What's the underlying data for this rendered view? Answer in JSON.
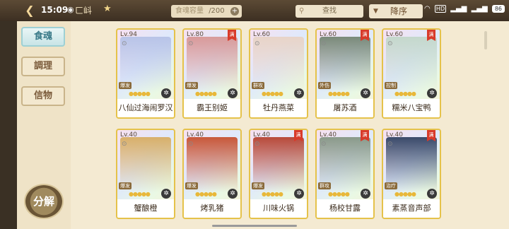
{
  "status_bar": {
    "time": "15:09",
    "wechat_icon": "wechat-icon",
    "title": "ㄈ㞳",
    "star_icon": "star-icon",
    "battery": "86",
    "hd": "HD"
  },
  "header": {
    "capacity_label": "食魂容量",
    "capacity_current": "",
    "capacity_total": "/200",
    "search_label": "查找",
    "sort_label": "降序"
  },
  "sidebar": {
    "tabs": [
      {
        "label": "食魂",
        "active": true
      },
      {
        "label": "調理",
        "active": false
      },
      {
        "label": "信物",
        "active": false
      }
    ],
    "decompose_label": "分解"
  },
  "cards": [
    {
      "level": "Lv.94",
      "name": "八仙过海闹罗汉",
      "tag": "爆发",
      "ribbon": false,
      "color": "#b8c4e8"
    },
    {
      "level": "Lv.80",
      "name": "霸王别姬",
      "tag": "爆发",
      "ribbon": true,
      "color": "#d89a9a"
    },
    {
      "level": "Lv.60",
      "name": "牡丹燕菜",
      "tag": "群攻",
      "ribbon": false,
      "color": "#e8d4c8"
    },
    {
      "level": "Lv.60",
      "name": "屠苏酒",
      "tag": "外伤",
      "ribbon": true,
      "color": "#7a8a7a"
    },
    {
      "level": "Lv.60",
      "name": "糯米八宝鸭",
      "tag": "控制",
      "ribbon": true,
      "color": "#c4d8cc"
    },
    {
      "level": "Lv.40",
      "name": "蟹酿橙",
      "tag": "爆发",
      "ribbon": false,
      "color": "#d8b06a"
    },
    {
      "level": "Lv.40",
      "name": "烤乳猪",
      "tag": "爆发",
      "ribbon": false,
      "color": "#c8583a"
    },
    {
      "level": "Lv.40",
      "name": "川味火锅",
      "tag": "爆发",
      "ribbon": true,
      "color": "#b84a3a"
    },
    {
      "level": "Lv.40",
      "name": "杨校甘露",
      "tag": "群攻",
      "ribbon": true,
      "color": "#8a9a8a"
    },
    {
      "level": "Lv.40",
      "name": "素蒸音声部",
      "tag": "治疗",
      "ribbon": true,
      "color": "#3a4a6a"
    }
  ]
}
